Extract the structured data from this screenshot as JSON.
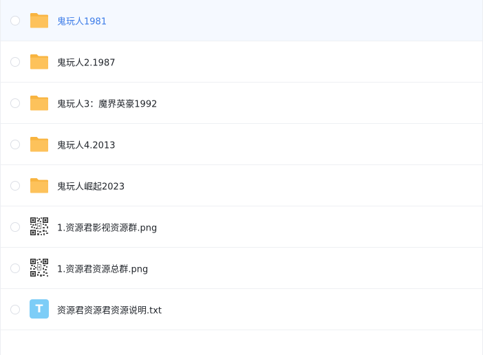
{
  "file_list": {
    "items": [
      {
        "name": "鬼玩人1981",
        "type": "folder",
        "icon": "folder-icon",
        "selected": true
      },
      {
        "name": "鬼玩人2.1987",
        "type": "folder",
        "icon": "folder-icon",
        "selected": false
      },
      {
        "name": "鬼玩人3：魔界英豪1992",
        "type": "folder",
        "icon": "folder-icon",
        "selected": false
      },
      {
        "name": "鬼玩人4.2013",
        "type": "folder",
        "icon": "folder-icon",
        "selected": false
      },
      {
        "name": "鬼玩人崛起2023",
        "type": "folder",
        "icon": "folder-icon",
        "selected": false
      },
      {
        "name": "1.资源君影视资源群.png",
        "type": "image",
        "icon": "qr-code-icon",
        "selected": false
      },
      {
        "name": "1.资源君资源总群.png",
        "type": "image",
        "icon": "qr-code-icon",
        "selected": false
      },
      {
        "name": "资源君资源君资源说明.txt",
        "type": "text",
        "icon": "text-file-icon",
        "icon_letter": "T",
        "selected": false
      }
    ]
  },
  "colors": {
    "folder": "#fdc25b",
    "folder_tab": "#f8b440",
    "selected_text": "#3b7be8",
    "selected_row": "#f5f9ff",
    "txt_icon": "#7dcdf7"
  }
}
